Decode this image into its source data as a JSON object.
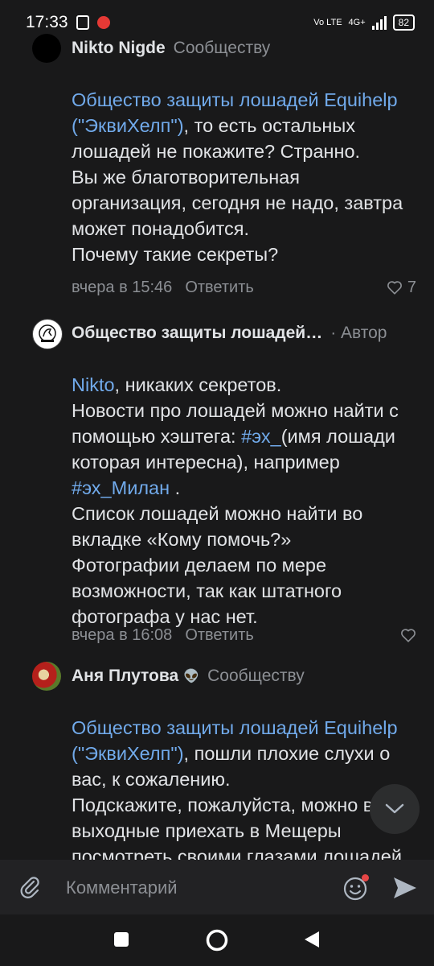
{
  "status_bar": {
    "time": "17:33",
    "network": "4G+",
    "volte": "Vo LTE",
    "battery": "82"
  },
  "comments": [
    {
      "author": "Nikto Nigde",
      "role": "Сообществу",
      "segments": [
        {
          "text": "Общество защиты лошадей Equihelp (\"ЭквиХелп\")",
          "link": true
        },
        {
          "text": ", то есть остальных лошадей не покажите? Странно.\nВы же благотворительная организация, сегодня не надо, завтра может понадобится.\nПочему такие секреты?",
          "link": false
        }
      ],
      "time": "вчера в 15:46",
      "reply": "Ответить",
      "likes": "7"
    },
    {
      "author": "Общество защиты лошадей…",
      "role": "· Автор",
      "segments": [
        {
          "text": "Nikto",
          "link": true
        },
        {
          "text": ", никаких секретов.\nНовости про лошадей можно найти с помощью хэштега: ",
          "link": false
        },
        {
          "text": "#эх_",
          "link": true
        },
        {
          "text": "(имя лошади которая интересна), например ",
          "link": false
        },
        {
          "text": "#эх_Милан",
          "link": true
        },
        {
          "text": " .\nСписок лошадей можно найти во вкладке «Кому помочь?»\nФотографии делаем по мере возможности, так как штатного фотографа у нас нет.",
          "link": false
        }
      ],
      "time": "вчера в 16:08",
      "reply": "Ответить",
      "likes": ""
    },
    {
      "author": "Аня Плутова",
      "role": "Сообществу",
      "segments": [
        {
          "text": "Общество защиты лошадей Equihelp (\"ЭквиХелп\")",
          "link": true
        },
        {
          "text": ", пошли плохие слухи о вас, к сожалению.\nПодскажите, пожалуйста, можно в выходные приехать в Мещеры посмотреть своими глазами лошадей и условия содержания?",
          "link": false
        }
      ],
      "time": "",
      "reply": "",
      "likes": ""
    }
  ],
  "composer": {
    "placeholder": "Комментарий"
  },
  "colors": {
    "background": "#19191a",
    "link": "#71aaeb",
    "secondary": "#8c8f94",
    "text": "#e1e3e6"
  },
  "icons": [
    "attach-icon",
    "emoji-icon",
    "send-icon",
    "heart-icon",
    "chevron-down-icon",
    "nav-home-icon",
    "nav-back-icon",
    "nav-recents-icon"
  ]
}
